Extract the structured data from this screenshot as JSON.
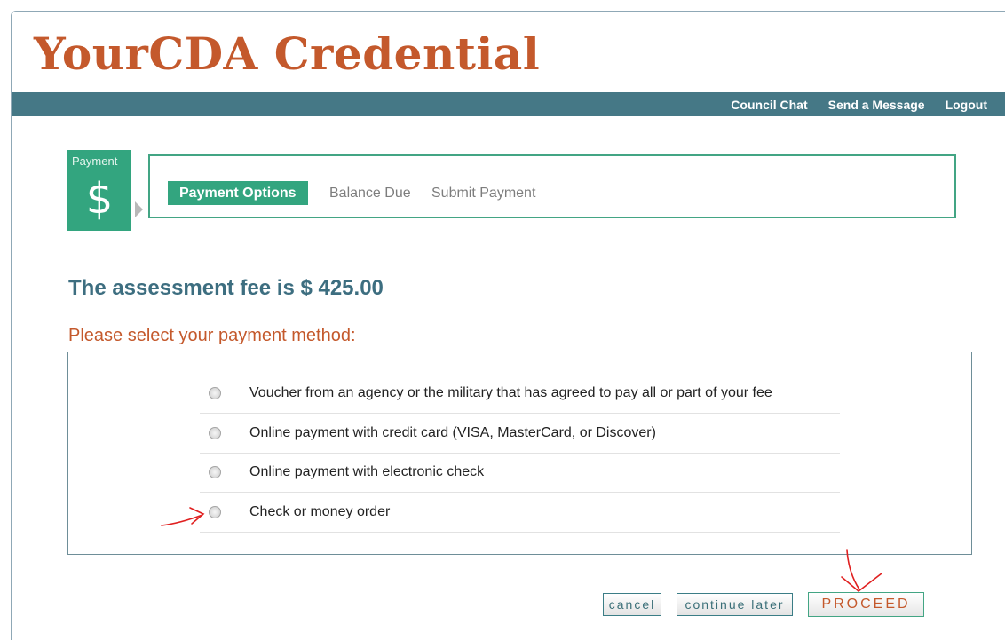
{
  "header": {
    "brand": "YourCDA Credential",
    "nav": [
      "Council Chat",
      "Send a Message",
      "Logout"
    ]
  },
  "payment_tile": {
    "label": "Payment",
    "symbol": "$"
  },
  "steps": {
    "active": "Payment Options",
    "items": [
      "Balance Due",
      "Submit Payment"
    ]
  },
  "fee": {
    "text": "The assessment fee is $ 425.00"
  },
  "prompt": "Please select your payment method:",
  "options": [
    "Voucher from an agency or the military that has agreed to pay all or part of your fee",
    "Online payment with credit card (VISA, MasterCard, or Discover)",
    "Online payment with electronic check",
    "Check or money order"
  ],
  "buttons": {
    "cancel": "cancel",
    "continue_later": "continue later",
    "proceed": "PROCEED"
  },
  "colors": {
    "brand": "#c4592c",
    "topbar": "#457886",
    "accent_green": "#33a57f",
    "annotation_red": "#e02020"
  },
  "icons": {
    "tile": "dollar-icon",
    "radio": "radio-button",
    "annotation": "red-arrow-annotation"
  }
}
